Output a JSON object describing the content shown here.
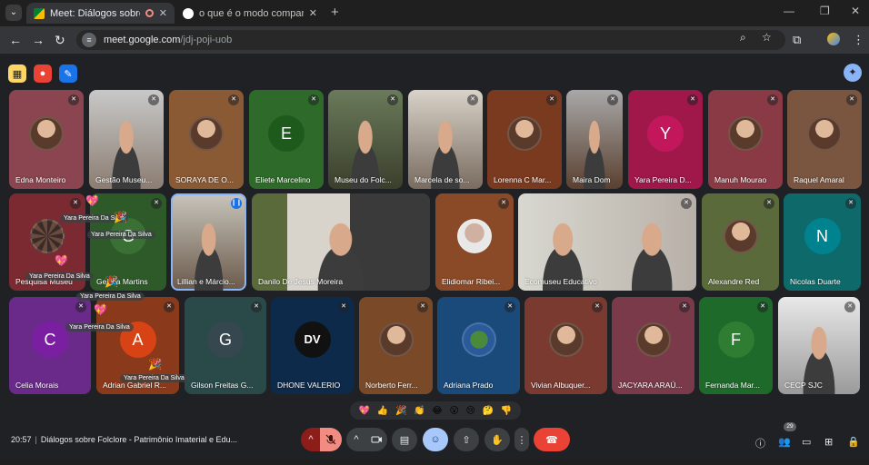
{
  "browser": {
    "tabs": [
      {
        "title": "Meet: Diálogos sobre Folclore",
        "active": true
      },
      {
        "title": "o que é o modo companion no",
        "active": false
      }
    ],
    "url_host": "meet.google.com",
    "url_path": "/jdj-poji-uob"
  },
  "meeting": {
    "time": "20:57",
    "title": "Diálogos sobre Folclore - Patrimônio Imaterial e Edu...",
    "participant_count": "29"
  },
  "tiles": {
    "t01": "Edna Monteiro",
    "t02": "Gestão Museu...",
    "t03": "SORAYA DE O...",
    "t04": "Eliete Marcelino",
    "t05": "Museu do Folc...",
    "t06": "Marcela de so...",
    "t07": "Lorenna C Mar...",
    "t08": "Maira Dom",
    "t09": "Yara Pereira D...",
    "t10": "Manuh Mourao",
    "t11": "Raquel Amaral",
    "t12": "Pesquisa Museu",
    "t13": "Geíiica Martins",
    "t14": "Lillian e Márcio...",
    "t15": "Danilo De Jesus Moreira",
    "t16": "Elidiomar Ribei...",
    "t17": "Ecomuseu Educativo",
    "t18": "Alexandre Red",
    "t19": "Nicolas Duarte",
    "t20": "Celia Morais",
    "t21": "Adrian Gabriel R...",
    "t22": "Gilson Freitas G...",
    "t23": "DHONE VALERIO",
    "t24": "Norberto Ferr...",
    "t25": "Adriana Prado",
    "t26": "Vivian Albuquer...",
    "t27": "JACYARA ARAÚ...",
    "t28": "Fernanda Mar...",
    "t29": "CECP SJC"
  },
  "letters": {
    "eliete": "E",
    "yara": "Y",
    "geiica": "G",
    "nicolas": "N",
    "celia": "C",
    "adrian": "A",
    "gilson": "G",
    "fernanda": "F"
  },
  "reaction_tag": "Yara Pereira Da Silva",
  "reactions": [
    "💖",
    "👍",
    "🎉",
    "👏",
    "😂",
    "😮",
    "😢",
    "🤔",
    "👎"
  ],
  "colors": {
    "accent": "#8ab4f8",
    "hangup": "#ea4335",
    "mic_off": "#f28b82",
    "emoji_on": "#a8c7fa"
  }
}
